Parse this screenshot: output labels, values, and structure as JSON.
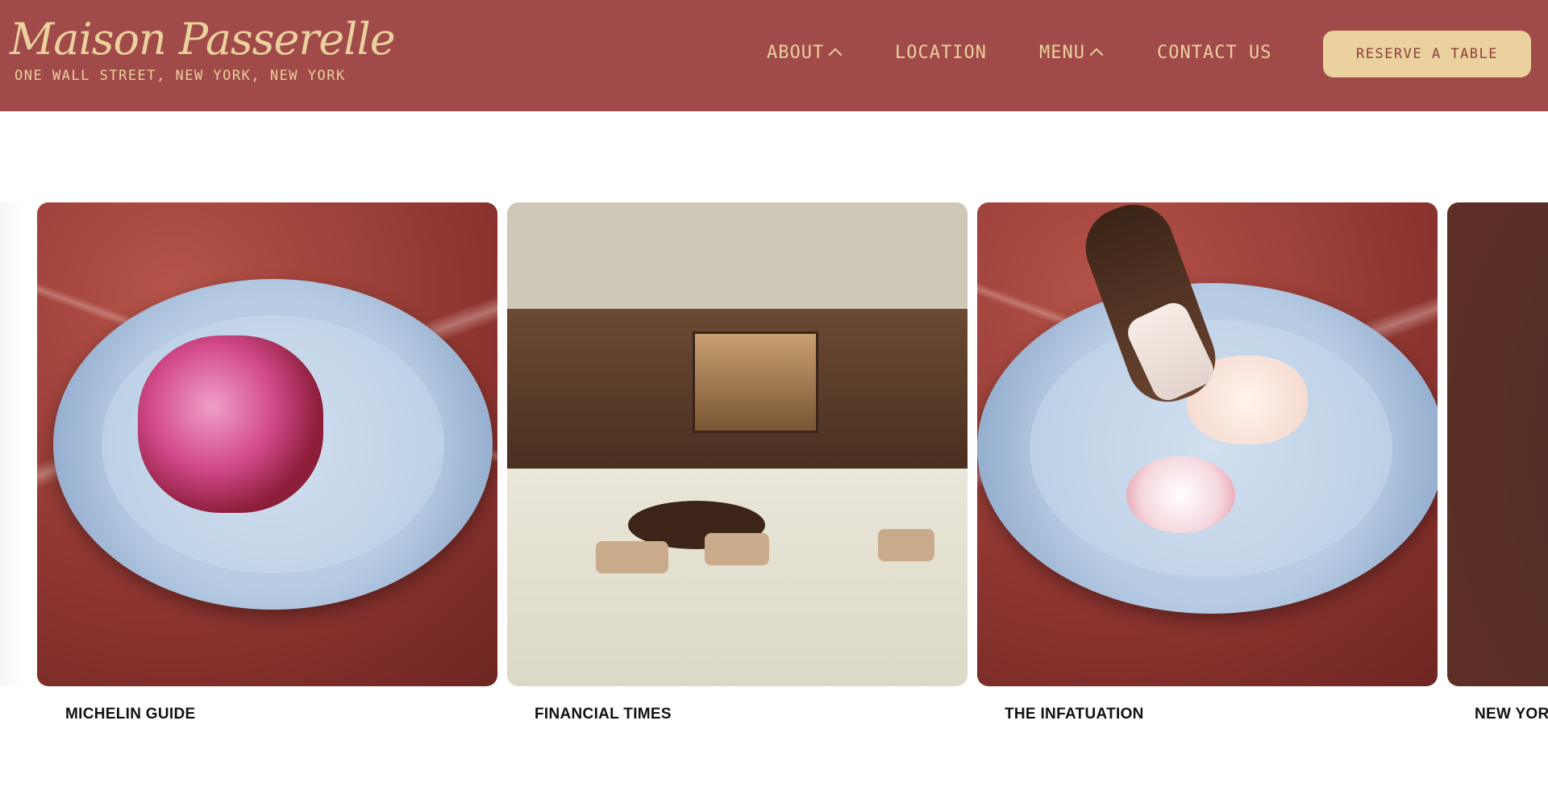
{
  "header": {
    "logo_name": "Maison Passerelle",
    "logo_address": "ONE WALL STREET, NEW YORK, NEW YORK",
    "nav": {
      "about": "ABOUT",
      "location": "LOCATION",
      "menu": "MENU",
      "contact": "CONTACT US"
    },
    "reserve_label": "RESERVE A TABLE"
  },
  "carousel": {
    "captions": [
      "MICHELIN GUIDE",
      "FINANCIAL TIMES",
      "THE INFATUATION",
      "NEW YORK"
    ]
  },
  "colors": {
    "header_bg": "#a14a4a",
    "accent_cream": "#ead19d",
    "button_text": "#8e3f3f"
  },
  "icons": [
    "chevron-up-icon"
  ]
}
